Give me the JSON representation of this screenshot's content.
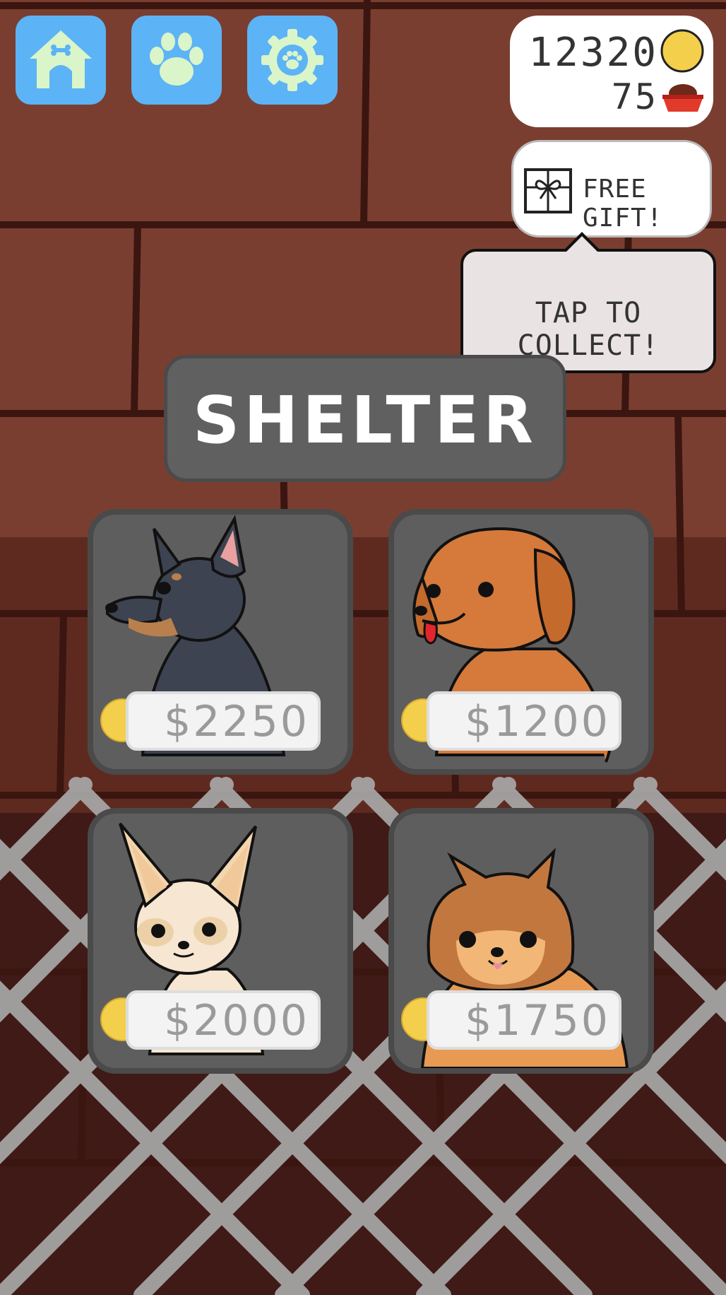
{
  "nav": {
    "home_icon": "doghouse-icon",
    "dogs_icon": "paw-icon",
    "settings_icon": "paw-gear-icon"
  },
  "currency": {
    "coins": "12320",
    "food": "75",
    "coin_icon": "coin-icon",
    "food_icon": "food-bowl-icon"
  },
  "gift": {
    "label": "FREE GIFT!",
    "icon": "gift-box-icon",
    "tooltip": "TAP TO COLLECT!"
  },
  "shelter": {
    "title": "SHELTER",
    "dogs": [
      {
        "breed_icon": "doberman-icon",
        "price": "$2250"
      },
      {
        "breed_icon": "golden-retriever-icon",
        "price": "$1200"
      },
      {
        "breed_icon": "chihuahua-icon",
        "price": "$2000"
      },
      {
        "breed_icon": "pomeranian-icon",
        "price": "$1750"
      }
    ]
  },
  "colors": {
    "nav_button": "#5cb3f5",
    "icon_fill": "#d9f5c9",
    "brick": "#7a3e30",
    "panel": "#5e5e5e",
    "coin": "#f3cf4b"
  }
}
